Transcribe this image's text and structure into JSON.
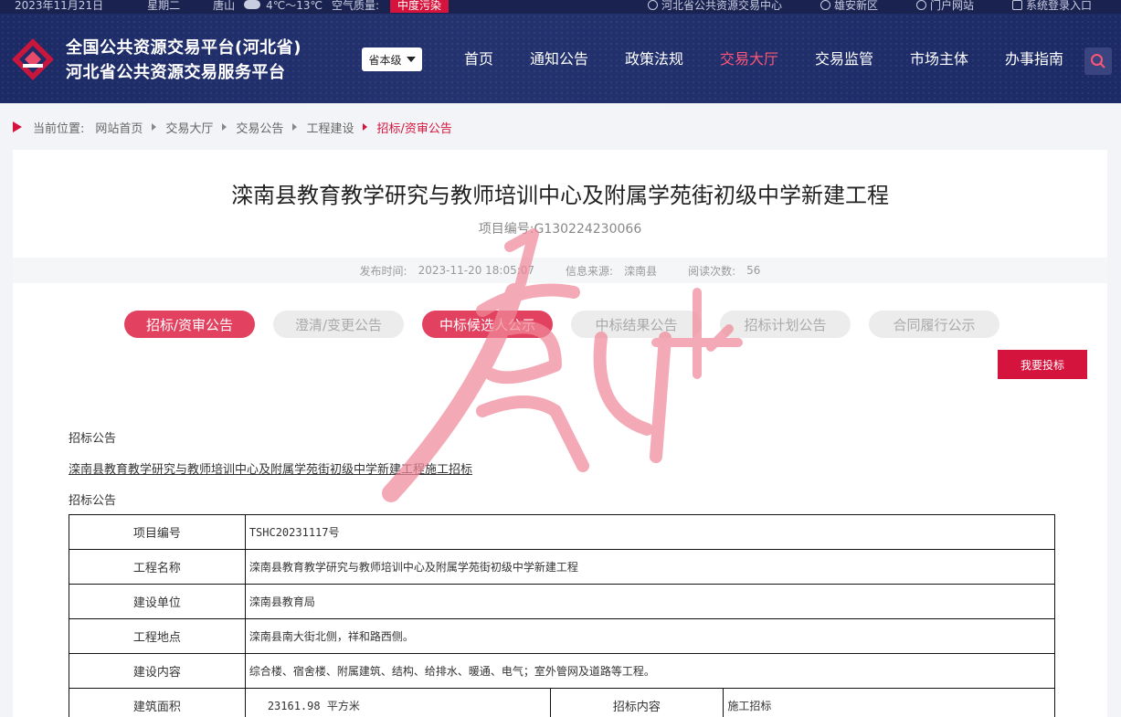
{
  "topbar": {
    "date": "2023年11月21日",
    "weekday": "星期二",
    "city": "唐山",
    "temperature": "4℃～13℃",
    "air_label": "空气质量:",
    "air_badge": "中度污染",
    "links": [
      "河北省公共资源交易中心",
      "雄安新区",
      "门户网站",
      "系统登录入口"
    ]
  },
  "header": {
    "brand_line1": "全国公共资源交易平台(河北省)",
    "brand_line2": "河北省公共资源交易服务平台",
    "level_select": "省本级",
    "nav": [
      "首页",
      "通知公告",
      "政策法规",
      "交易大厅",
      "交易监管",
      "市场主体",
      "办事指南"
    ],
    "nav_active": "交易大厅"
  },
  "breadcrumb": {
    "label": "当前位置:",
    "items": [
      "网站首页",
      "交易大厅",
      "交易公告",
      "工程建设"
    ],
    "current": "招标/资审公告"
  },
  "article": {
    "title": "滦南县教育教学研究与教师培训中心及附属学苑街初级中学新建工程",
    "project_no_label": "项目编号:",
    "project_no": "G130224230066",
    "publish_label": "发布时间:",
    "publish_time": "2023-11-20 18:05:07",
    "source_label": "信息来源:",
    "source": "滦南县",
    "views_label": "阅读次数:",
    "views": "56",
    "tabs": [
      "招标/资审公告",
      "澄清/变更公告",
      "中标候选人公示",
      "中标结果公告",
      "招标计划公告",
      "合同履行公示"
    ],
    "bid_button": "我要投标",
    "section1": "招标公告",
    "subtitle": "滦南县教育教学研究与教师培训中心及附属学苑街初级中学新建工程施工招标",
    "section2": "招标公告"
  },
  "table": {
    "rows": [
      {
        "k": "项目编号",
        "v": "TSHC20231117号"
      },
      {
        "k": "工程名称",
        "v": "滦南县教育教学研究与教师培训中心及附属学苑街初级中学新建工程"
      },
      {
        "k": "建设单位",
        "v": "滦南县教育局"
      },
      {
        "k": "工程地点",
        "v": "滦南县南大街北侧，祥和路西侧。"
      },
      {
        "k": "建设内容",
        "v": "综合楼、宿舍楼、附属建筑、结构、给排水、暖通、电气；室外管网及道路等工程。"
      }
    ],
    "last_row": {
      "k1": "建筑面积",
      "v1": "23161.98 平方米",
      "k2": "招标内容",
      "v2": "施工招标"
    }
  },
  "colors": {
    "accent": "#d4143c",
    "nav_bg": "#1f2c68",
    "tab_active": "#e2415f"
  }
}
